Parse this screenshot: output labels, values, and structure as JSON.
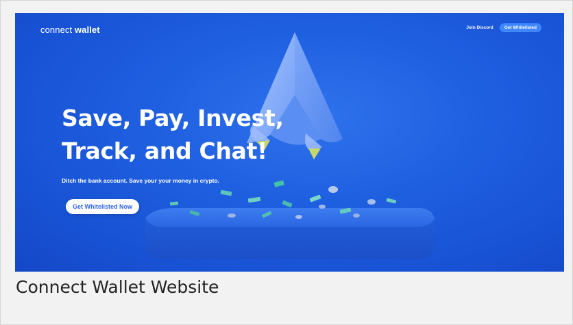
{
  "header": {
    "logo_prefix": "connect",
    "logo_bold": "wallet",
    "nav_link": "Join Discord",
    "nav_button": "Get Whitelisted"
  },
  "hero": {
    "headline_line1": "Save, Pay, Invest,",
    "headline_line2": "Track, and Chat!",
    "subtext": "Ditch the bank account. Save your your money in crypto.",
    "cta_label": "Get Whitelisted Now"
  },
  "caption": "Connect Wallet Website",
  "colors": {
    "hero_background": "#1e5fe0",
    "nav_button": "#3f86ff",
    "cta_text": "#2b63e6",
    "caption_text": "#222222"
  }
}
